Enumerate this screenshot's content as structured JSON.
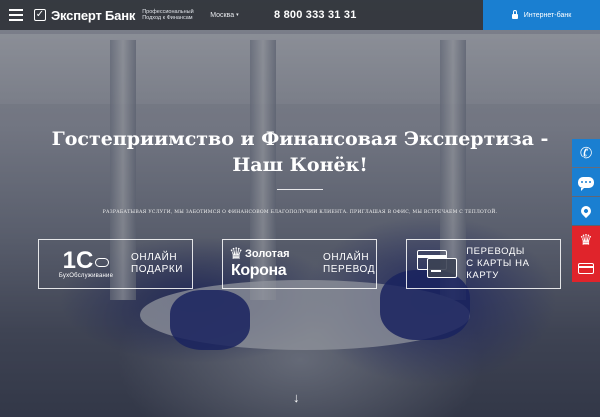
{
  "header": {
    "brand": "Эксперт Банк",
    "tagline": "Профессиональный Подход к Финансам",
    "city": "Москва",
    "phone": "8 800 333 31 31",
    "internet_bank": "Интернет-банк"
  },
  "hero": {
    "title": "Гостеприимство и Финансовая Экспертиза - Наш Конёк!",
    "subtitle": "РАЗРАБАТЫВАЯ УСЛУГИ, МЫ ЗАБОТИМСЯ О ФИНАНСОВОМ БЛАГОПОЛУЧИИ КЛИЕНТА. ПРИГЛАШАЯ В ОФИС, МЫ ВСТРЕЧАЕМ С ТЕПЛОТОЙ."
  },
  "offers": [
    {
      "logo_main": "1С",
      "logo_sub": "БухОбслуживание",
      "line1": "ОНЛАЙН",
      "line2": "ПОДАРКИ"
    },
    {
      "logo_line1": "Золотая",
      "logo_line2": "Корона",
      "line1": "ОНЛАЙН",
      "line2": "ПЕРЕВОД"
    },
    {
      "line1": "ПЕРЕВОДЫ",
      "line2": "С КАРТЫ НА КАРТУ"
    }
  ],
  "side_widgets": [
    "phone-icon",
    "chat-icon",
    "location-icon",
    "crown-icon",
    "card-icon"
  ],
  "colors": {
    "primary_blue": "#1a7fd1",
    "accent_red": "#e0242b"
  }
}
